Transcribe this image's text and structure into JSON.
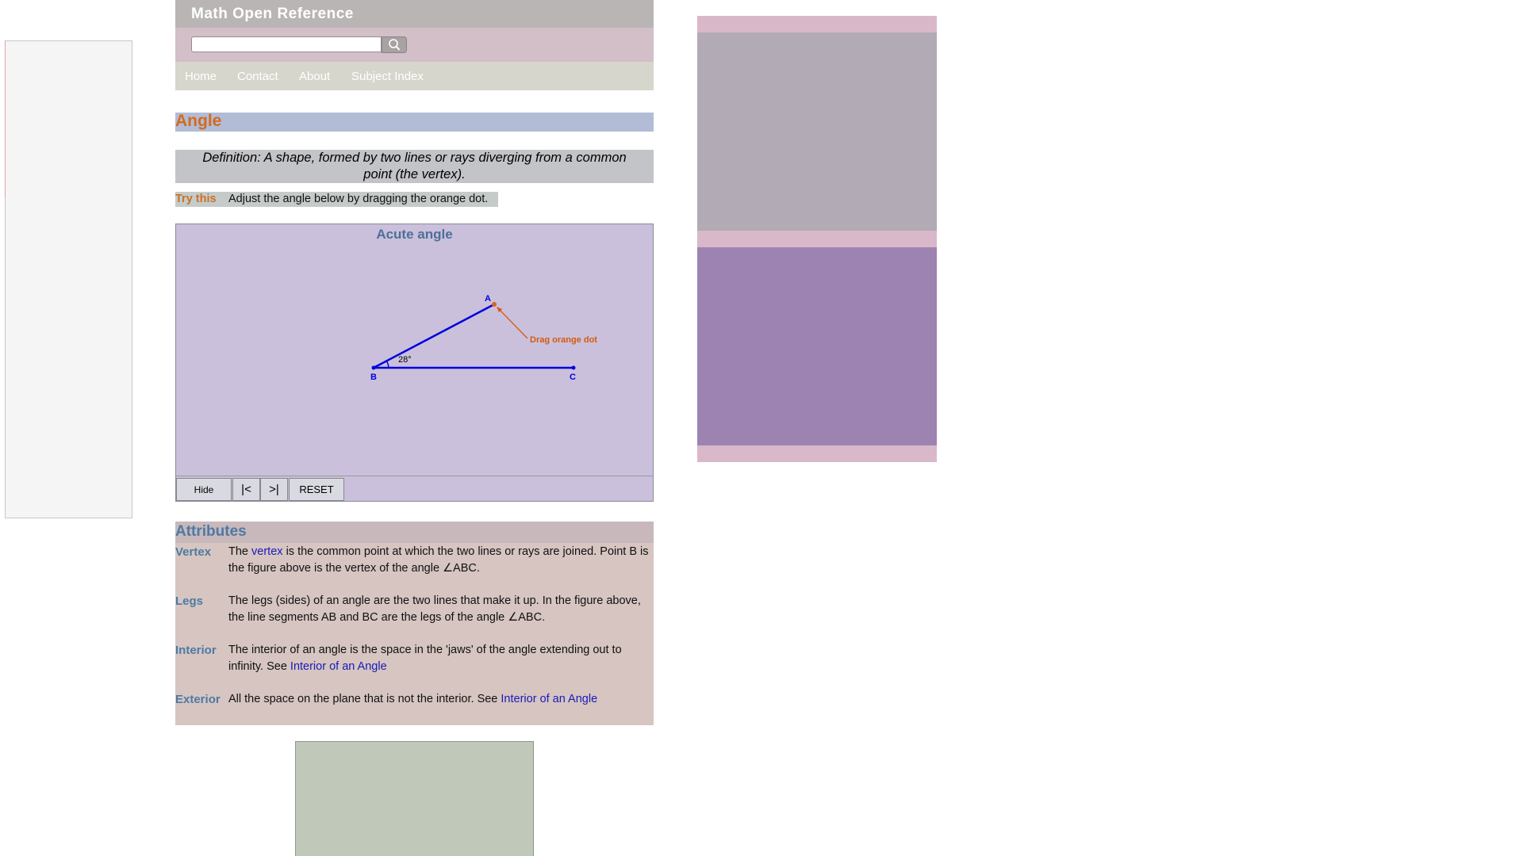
{
  "site": {
    "title": "Math Open Reference",
    "search_placeholder": "",
    "nav": [
      "Home",
      "Contact",
      "About",
      "Subject Index"
    ]
  },
  "page": {
    "title": "Angle",
    "definition": "Definition: A shape, formed by two lines or rays diverging from a common point (the vertex).",
    "try_label": "Try this",
    "try_text": "Adjust the angle below by dragging the orange dot."
  },
  "applet": {
    "title": "Acute angle",
    "angle_label": "28°",
    "angle_degrees": 28,
    "points": {
      "vertex": "B",
      "arm_end": "A",
      "base_end": "C"
    },
    "drag_hint": "Drag orange dot",
    "buttons": {
      "hide": "Hide",
      "prev": "|<",
      "next": ">|",
      "reset": "RESET"
    },
    "colors": {
      "lines": "#0000dd",
      "hint": "#d45a10",
      "background": "#cac0db"
    }
  },
  "attributes": {
    "title": "Attributes",
    "vertex": {
      "term": "Vertex",
      "pre": "The",
      "link": "vertex",
      "post": "is the common point at which the two lines or rays are joined. Point B is the figure above is the vertex of the angle ∠ABC."
    },
    "legs": {
      "term": "Legs",
      "text": "The legs (sides) of an angle are the two lines that make it up. In the figure above, the line segments AB and BC are the legs of the angle ∠ABC."
    },
    "interior": {
      "term": "Interior",
      "pre": "The interior of an angle is the space in the 'jaws' of the angle extending out to infinity. See",
      "link": "Interior of an Angle"
    },
    "exterior": {
      "term": "Exterior",
      "pre": "All the space on the plane that is not the interior. See",
      "link": "Interior of an Angle"
    }
  },
  "colors": {
    "accent_orange": "#d46a1e",
    "term_blue": "#4d7aa3",
    "link_blue": "#1a1ab8"
  }
}
